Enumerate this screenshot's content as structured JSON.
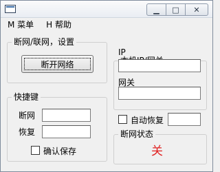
{
  "window": {
    "minimize_glyph": "▁",
    "maximize_glyph": "□",
    "close_glyph": "✕"
  },
  "menu": {
    "items": [
      {
        "label": "M 菜单"
      },
      {
        "label": "H 帮助"
      }
    ]
  },
  "network_group": {
    "legend": "断网/联网，设置",
    "disconnect_button": "断开网络"
  },
  "ip_group": {
    "legend": "本机IP/网关",
    "ip_label": "IP",
    "ip_value": "",
    "gateway_label": "网关",
    "gateway_value": ""
  },
  "hotkey_group": {
    "legend": "快捷键",
    "disconnect_label": "断网",
    "disconnect_value": "",
    "restore_label": "恢复",
    "restore_value": "",
    "confirm_save_label": "确认保存",
    "confirm_save_checked": false
  },
  "auto_restore": {
    "label": "自动恢复",
    "checked": false,
    "value": ""
  },
  "status_group": {
    "legend": "断网状态",
    "value": "关",
    "value_color": "#e02020"
  }
}
